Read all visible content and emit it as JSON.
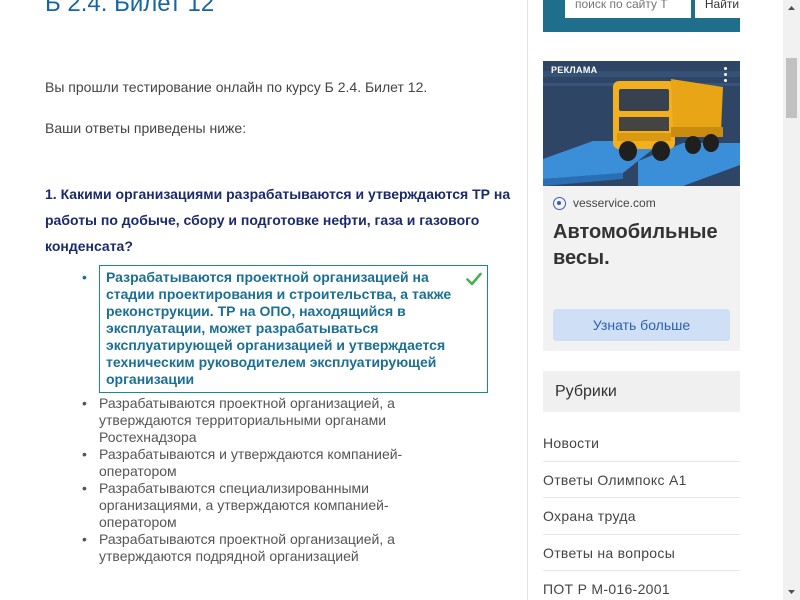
{
  "page": {
    "title": "Б 2.4. Билет 12",
    "intro": "Вы прошли тестирование онлайн по курсу Б 2.4. Билет 12.",
    "answers_note": "Ваши ответы приведены ниже:"
  },
  "question": {
    "text": "1. Какими организациями разрабатываются и утверждаются ТР на работы по добыче, сбору и подготовке нефти, газа и газового конденсата?",
    "answers": [
      {
        "text": "Разрабатываются проектной организацией на стадии проектирования и строительства, а также реконструкции. ТР на ОПО, находящийся в эксплуатации, может разрабатываться эксплуатирующей организацией и утверждается техническим руководителем эксплуатирующей организации",
        "correct": true
      },
      {
        "text": "Разрабатываются проектной организацией, а утверждаются территориальными органами Ростехнадзора",
        "correct": false
      },
      {
        "text": "Разрабатываются и утверждаются компанией-оператором",
        "correct": false
      },
      {
        "text": "Разрабатываются специализированными организациями, а утверждаются компанией-оператором",
        "correct": false
      },
      {
        "text": "Разрабатываются проектной организацией, а утверждаются подрядной организацией",
        "correct": false
      }
    ]
  },
  "search": {
    "placeholder": "поиск по сайту Т",
    "button_label": "Найти"
  },
  "ad": {
    "label": "РЕКЛАМА",
    "source": "vesservice.com",
    "headline": "Автомобильные весы.",
    "cta": "Узнать больше"
  },
  "rubrics": {
    "header": "Рубрики",
    "items": [
      "Новости",
      "Ответы Олимпокс А1",
      "Охрана труда",
      "Ответы на вопросы",
      "ПОТ Р М-016-2001"
    ]
  },
  "colors": {
    "accent": "#1565a6",
    "question": "#1a2a6c",
    "correct": "#1b6f93",
    "check": "#4caf50",
    "search_bg": "#1f6e8c",
    "cta_bg": "#cfe0f6"
  }
}
